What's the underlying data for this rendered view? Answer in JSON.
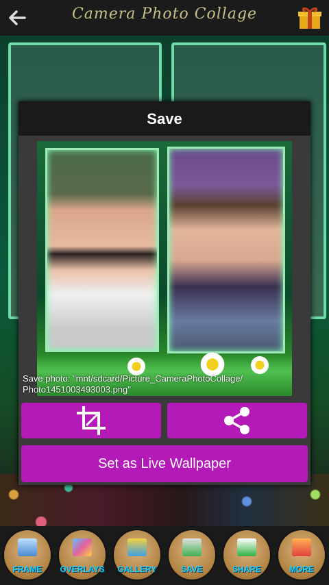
{
  "header": {
    "title": "Camera Photo Collage",
    "back_icon": "back-arrow-icon",
    "gift_icon": "gift-icon"
  },
  "dialog": {
    "title": "Save",
    "save_message": "Save photo: \"mnt/sdcard/Picture_CameraPhotoCollage/\nPhoto1451003493003.png\"",
    "crop_icon": "crop-icon",
    "share_icon": "share-icon",
    "wallpaper_label": "Set as Live Wallpaper",
    "accent_color": "#b41ab8"
  },
  "toolbar": {
    "items": [
      {
        "label": "FRAME",
        "icon": "frame-icon"
      },
      {
        "label": "OVERLAYS",
        "icon": "overlays-icon"
      },
      {
        "label": "GALLERY",
        "icon": "gallery-icon"
      },
      {
        "label": "SAVE",
        "icon": "save-icon"
      },
      {
        "label": "SHARE",
        "icon": "share-icon"
      },
      {
        "label": "MORE",
        "icon": "more-icon"
      }
    ]
  }
}
